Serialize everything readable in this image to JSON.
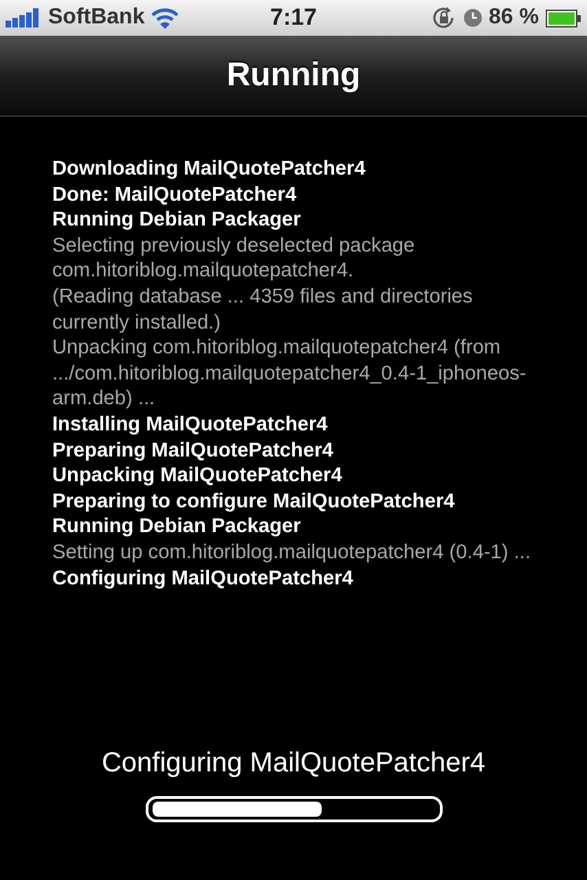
{
  "status_bar": {
    "carrier": "SoftBank",
    "time": "7:17",
    "battery": "86 %"
  },
  "nav_bar": {
    "title": "Running"
  },
  "log": [
    {
      "kind": "bold",
      "text": "Downloading MailQuotePatcher4"
    },
    {
      "kind": "bold",
      "text": "Done: MailQuotePatcher4"
    },
    {
      "kind": "bold",
      "text": "Running Debian Packager"
    },
    {
      "kind": "plain",
      "text": "Selecting previously deselected package com.hitoriblog.mailquotepatcher4."
    },
    {
      "kind": "plain",
      "text": "(Reading database ... 4359 files and directories currently installed.)"
    },
    {
      "kind": "plain",
      "text": "Unpacking com.hitoriblog.mailquotepatcher4 (from .../com.hitoriblog.mailquotepatcher4_0.4-1_iphoneos-arm.deb) ..."
    },
    {
      "kind": "bold",
      "text": "Installing MailQuotePatcher4"
    },
    {
      "kind": "bold",
      "text": "Preparing MailQuotePatcher4"
    },
    {
      "kind": "bold",
      "text": "Unpacking MailQuotePatcher4"
    },
    {
      "kind": "bold",
      "text": "Preparing to configure MailQuotePatcher4"
    },
    {
      "kind": "bold",
      "text": "Running Debian Packager"
    },
    {
      "kind": "plain",
      "text": "Setting up com.hitoriblog.mailquotepatcher4 (0.4-1) ..."
    },
    {
      "kind": "bold",
      "text": "Configuring MailQuotePatcher4"
    }
  ],
  "progress": {
    "label": "Configuring MailQuotePatcher4",
    "level": 0.6
  }
}
